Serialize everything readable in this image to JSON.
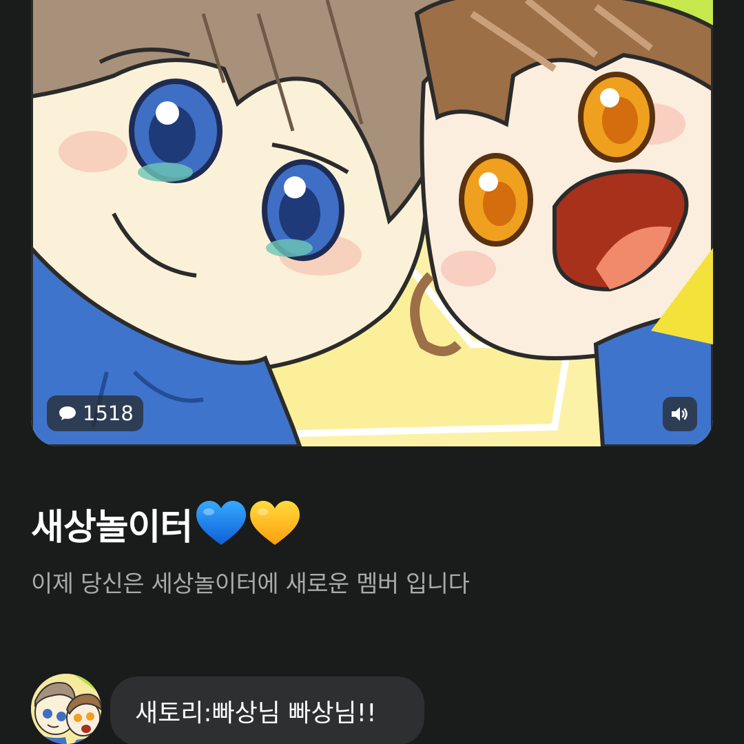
{
  "video": {
    "comment_count": "1518",
    "comment_icon": "speech-bubble-icon",
    "sound_icon": "speaker-volume-icon"
  },
  "post": {
    "title": "새상놀이터",
    "title_hearts": [
      "blue-heart-emoji",
      "yellow-heart-emoji"
    ],
    "subtitle": "이제 당신은 세상놀이터에 새로운 멤버 입니다"
  },
  "comment": {
    "text": "새토리:빠상님 빠상님!!"
  },
  "colors": {
    "background": "#1a1b1b",
    "blue_heart": "#1a7cf0",
    "yellow_heart": "#ffbf1f",
    "bubble": "#2e2f30",
    "subtitle": "#a9a9a9"
  }
}
